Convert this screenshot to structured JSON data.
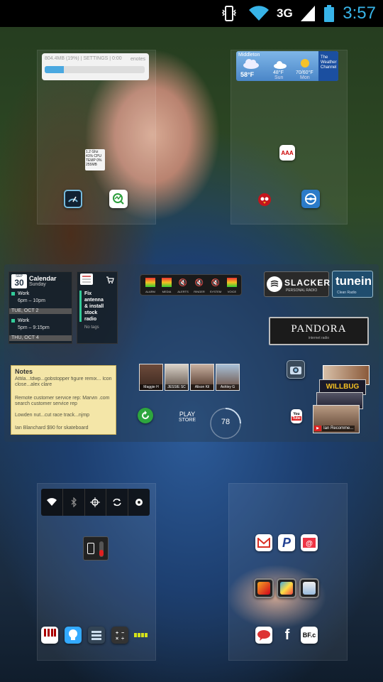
{
  "status_bar": {
    "network_type": "3G",
    "time": "3:57",
    "icons": [
      "vibrate-icon",
      "wifi-icon",
      "network-3g-icon",
      "signal-icon",
      "battery-icon"
    ]
  },
  "memory_widget": {
    "text": "804.4MB (19%) | SETTINGS | 0:00",
    "right_text": "enotes",
    "progress_fraction": 0.19
  },
  "weather_widget": {
    "location": "Middleton",
    "current_temp": "58°F",
    "days": [
      {
        "label": "Sun",
        "icon": "cloud-icon",
        "temp": "48°F"
      },
      {
        "label": "Mon",
        "icon": "sun-icon",
        "temp": "70/60°F"
      }
    ],
    "brand_line1": "The",
    "brand_line2": "Weather",
    "brand_line3": "Channel"
  },
  "cpu_widget": {
    "line1": "1.2 Ghz",
    "line2": "41% CPU",
    "line3": "TEMP 0%",
    "line4": "255MB"
  },
  "calendar_widget": {
    "month": "SEP",
    "day_number": "30",
    "title": "Calendar",
    "weekday": "Sunday",
    "events": [
      {
        "name": "Work",
        "time": "6pm – 10pm"
      },
      {
        "date": "TUE, OCT 2"
      },
      {
        "name": "Work",
        "time": "5pm – 9:15pm"
      },
      {
        "date": "THU, OCT 4"
      }
    ]
  },
  "task_widget": {
    "items": [
      "Fix",
      "antenna",
      "& install",
      "stock",
      "radio"
    ],
    "tag": "No tags"
  },
  "volume_widget": {
    "labels": [
      "ALARM",
      "MEDIA",
      "ALERTS",
      "RINGER",
      "SYSTEM",
      "VOICE"
    ],
    "levels": [
      0.8,
      0.8,
      0,
      0,
      0,
      0.8
    ]
  },
  "slacker": {
    "name": "SLACKER",
    "sub": "PERSONAL RADIO"
  },
  "tunein": {
    "name": "tunein",
    "sub": "Clean Radio"
  },
  "pandora": {
    "name": "PANDORA",
    "sub": "internet radio"
  },
  "notes_widget": {
    "title": "Notes",
    "lines": [
      "Attila...tdwp...gobstopper figure remix... Icon close...alex clare",
      "Remote customer service rep: Marvin .com search customer service rep",
      "Lowden nut...cut race track...njmp",
      "Ian Blanchard $90 for skateboard"
    ]
  },
  "contacts": [
    {
      "name": "Maggie H"
    },
    {
      "name": "JESSIE SC"
    },
    {
      "name": "Alison Kil"
    },
    {
      "name": "Ashley G"
    }
  ],
  "play_store": {
    "line1": "PLAY",
    "line2": "STORE"
  },
  "temperature_gauge": {
    "value": "78"
  },
  "video_thumbnails": {
    "caption1": "WILLBUG",
    "caption2": "Ian Recomme..."
  },
  "toggles": [
    "wifi-icon",
    "bluetooth-icon",
    "gps-icon",
    "sync-icon",
    "brightness-icon"
  ],
  "sms_icons": {
    "bottom_row": [
      "piano-app-icon",
      "bulb-app-icon",
      "list-app-icon",
      "calculator-app-icon",
      "dotted-app-icon"
    ]
  },
  "social": {
    "facebook": "f",
    "bf": "BF.c"
  },
  "colors": {
    "accent": "#38b4e8",
    "statusbar": "#000000"
  }
}
